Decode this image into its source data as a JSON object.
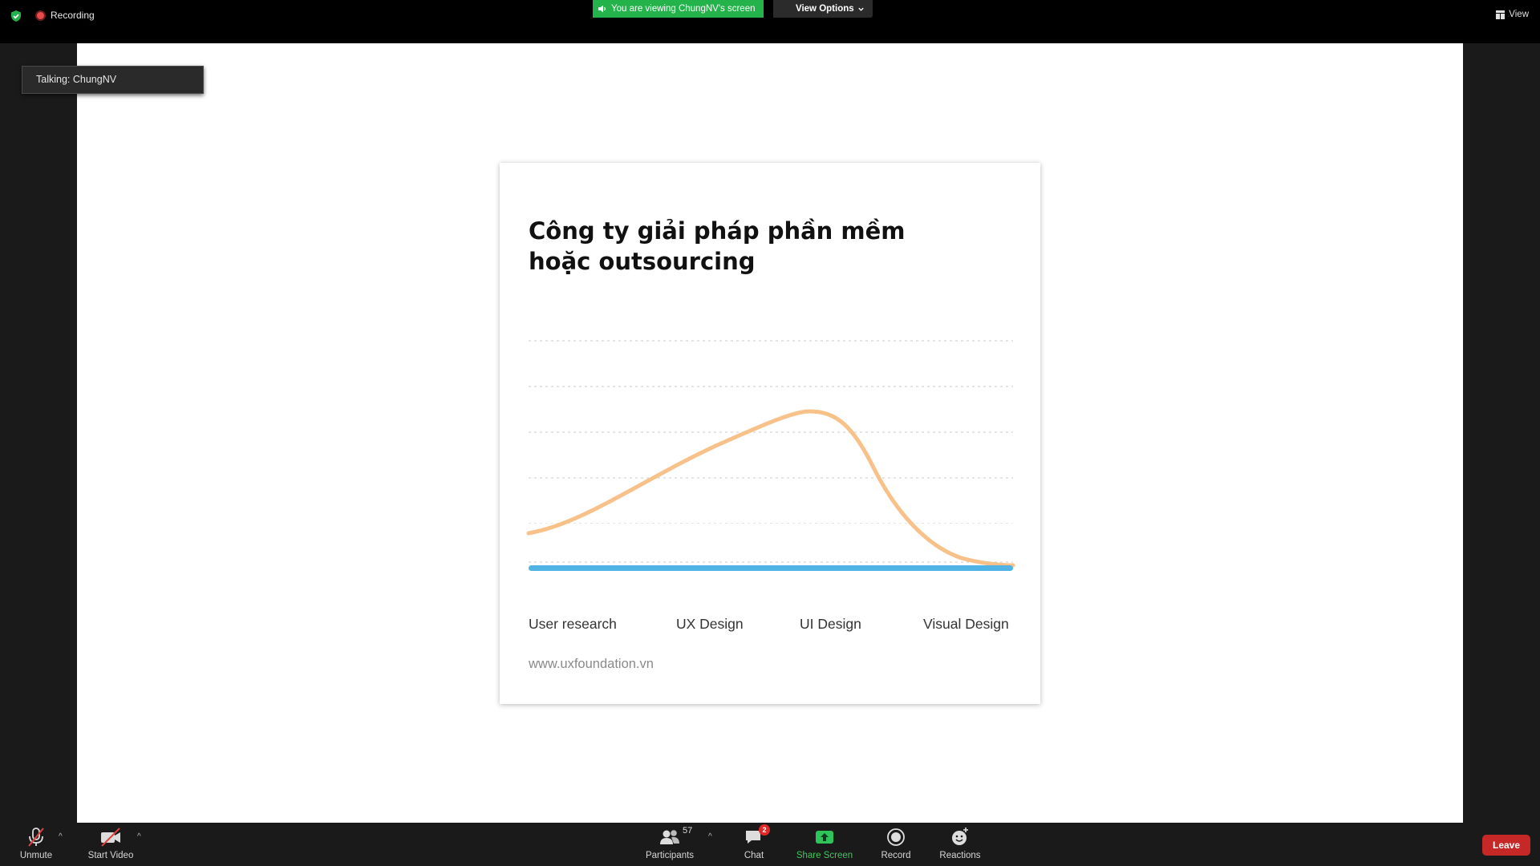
{
  "top": {
    "recording_label": "Recording",
    "viewing_text": "You are viewing ChungNV's screen",
    "view_options_label": "View Options",
    "view_label": "View"
  },
  "talking_label": "Talking: ChungNV",
  "slide": {
    "title": "Công ty giải pháp phần mềm hoặc outsourcing",
    "axis_labels": [
      "User research",
      "UX Design",
      "UI Design",
      "Visual Design"
    ],
    "url": "www.uxfoundation.vn",
    "colors": {
      "curve": "#f7c189",
      "axis": "#4fb3e6",
      "grid": "#d5d5d5"
    }
  },
  "toolbar": {
    "unmute_label": "Unmute",
    "start_video_label": "Start Video",
    "participants_label": "Participants",
    "participants_count": "57",
    "chat_label": "Chat",
    "chat_badge": "2",
    "share_screen_label": "Share Screen",
    "record_label": "Record",
    "reactions_label": "Reactions",
    "leave_label": "Leave"
  }
}
